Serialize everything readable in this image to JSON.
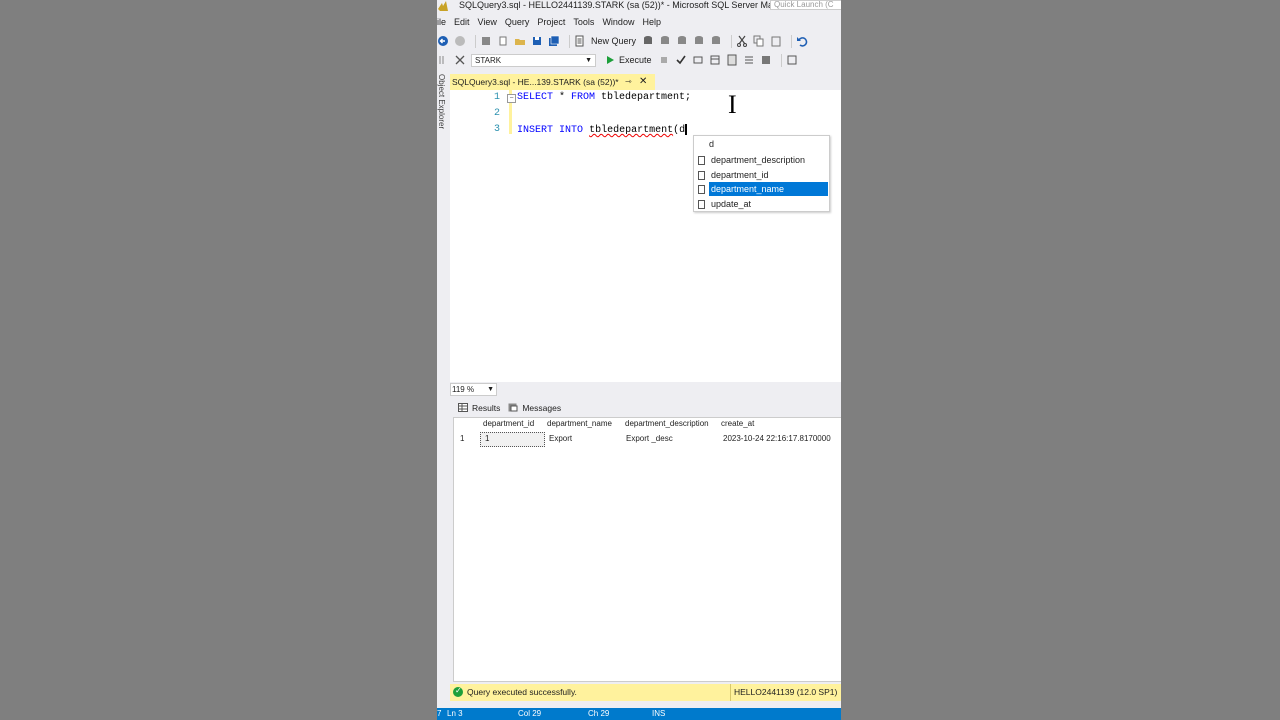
{
  "window": {
    "title": "SQLQuery3.sql - HELLO2441139.STARK (sa (52))* - Microsoft SQL Server Ma...",
    "quick_launch_placeholder": "Quick Launch (C"
  },
  "menu": [
    "ile",
    "Edit",
    "View",
    "Query",
    "Project",
    "Tools",
    "Window",
    "Help"
  ],
  "toolbar": {
    "new_query_label": "New Query",
    "database_selected": "STARK",
    "execute_label": "Execute"
  },
  "side_panel_label": "Object Explorer",
  "doc_tab": {
    "label": "SQLQuery3.sql - HE...139.STARK (sa (52))*",
    "pin": "⇾",
    "close": "✕"
  },
  "editor": {
    "line_numbers": [
      "1",
      "2",
      "3"
    ],
    "line1_kw1": "SELECT",
    "line1_star": " * ",
    "line1_kw2": "FROM",
    "line1_rest": " tbledepartment;",
    "line3_kw1": "INSERT",
    "line3_kw2": "INTO",
    "line3_table": "tbledepartment",
    "line3_rest": "(d"
  },
  "completion": {
    "typed": "d",
    "items": [
      "department_description",
      "department_id",
      "department_name",
      "update_at"
    ],
    "selected": "department_name"
  },
  "zoom": "119 %",
  "results_tabs": {
    "results": "Results",
    "messages": "Messages"
  },
  "results_grid": {
    "headers": [
      "department_id",
      "department_name",
      "department_description",
      "create_at"
    ],
    "rows": [
      {
        "row_num": "1",
        "department_id": "1",
        "department_name": "Export",
        "department_description": "Export _desc",
        "create_at": "2023-10-24 22:16:17.8170000"
      }
    ]
  },
  "status": {
    "message": "Query executed successfully.",
    "server": "HELLO2441139 (12.0 SP1)"
  },
  "bottom_status": {
    "left": "7",
    "ln": "Ln 3",
    "col": "Col 29",
    "ch": "Ch 29",
    "mode": "INS"
  },
  "colors": {
    "accent_blue": "#007acc",
    "tab_yellow": "#fff29d",
    "keyword_blue": "#0000ff",
    "selection_blue": "#0078d7",
    "success_green": "#1d9f3a"
  }
}
